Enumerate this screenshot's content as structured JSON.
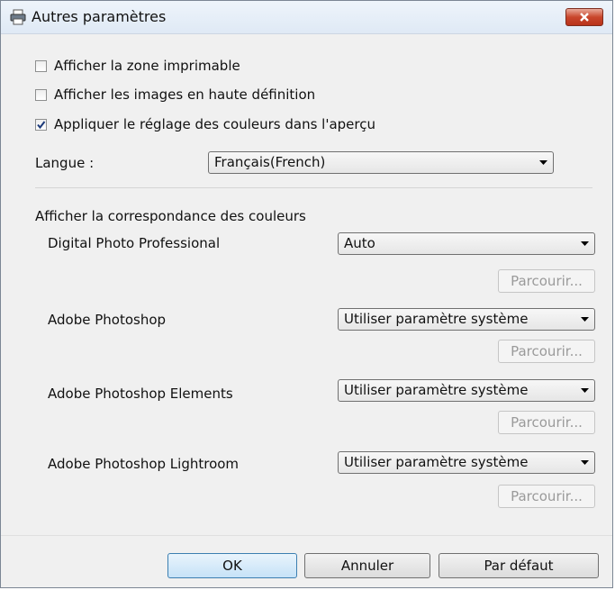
{
  "window": {
    "title": "Autres paramètres"
  },
  "options": {
    "show_printable_area": {
      "label": "Afficher la zone imprimable",
      "checked": false
    },
    "show_hd_images": {
      "label": "Afficher les images en haute définition",
      "checked": false
    },
    "apply_color_preview": {
      "label": "Appliquer le réglage des couleurs dans l'aperçu",
      "checked": true
    }
  },
  "language": {
    "label": "Langue :",
    "value": "Français(French)"
  },
  "color_matching": {
    "heading": "Afficher la correspondance des couleurs",
    "apps": [
      {
        "name": "Digital Photo Professional",
        "value": "Auto",
        "browse": "Parcourir..."
      },
      {
        "name": "Adobe Photoshop",
        "value": "Utiliser paramètre système",
        "browse": "Parcourir..."
      },
      {
        "name": "Adobe Photoshop Elements",
        "value": "Utiliser paramètre système",
        "browse": "Parcourir..."
      },
      {
        "name": "Adobe Photoshop Lightroom",
        "value": "Utiliser paramètre système",
        "browse": "Parcourir..."
      }
    ]
  },
  "buttons": {
    "ok": "OK",
    "cancel": "Annuler",
    "default": "Par défaut"
  }
}
